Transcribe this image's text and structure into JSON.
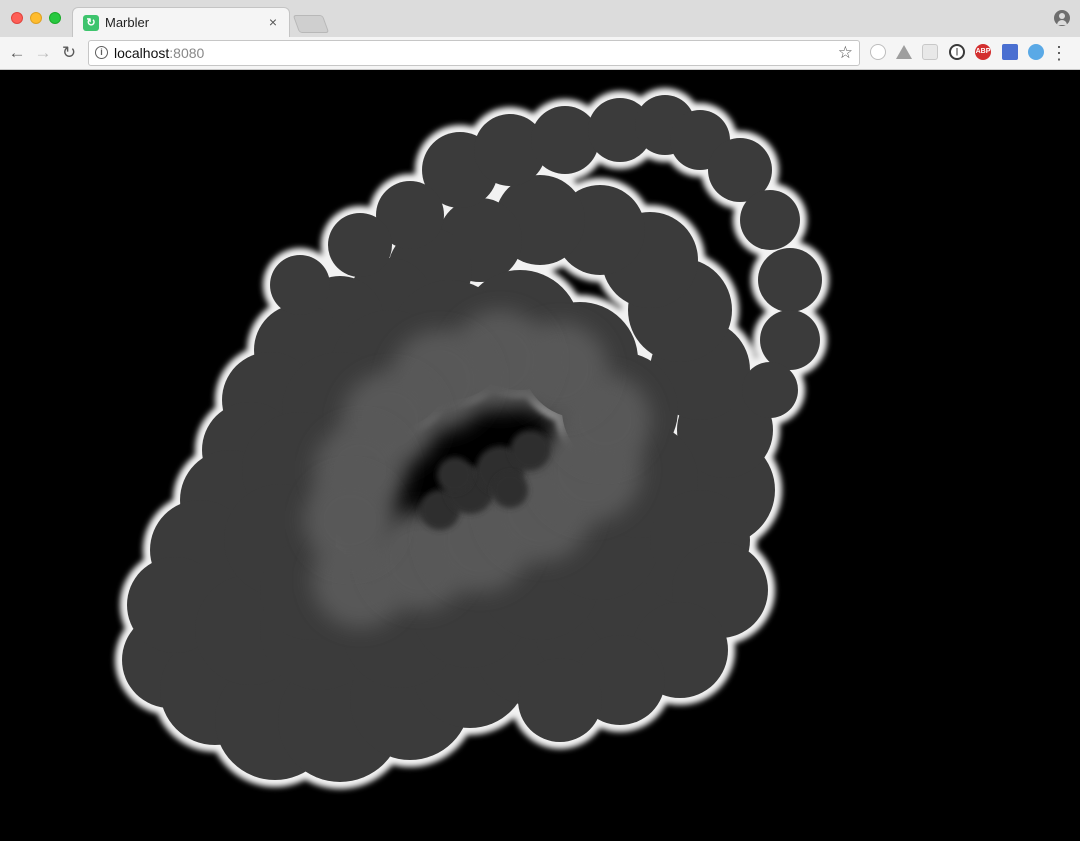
{
  "tab": {
    "title": "Marbler",
    "favicon_glyph": "↻",
    "close_glyph": "×"
  },
  "toolbar": {
    "back_glyph": "←",
    "forward_glyph": "→",
    "reload_glyph": "↻",
    "info_glyph": "i",
    "url_host": "localhost",
    "url_port": ":8080",
    "star_glyph": "☆",
    "menu_glyph": "⋮"
  },
  "extensions": [
    {
      "name": "circle-ext-icon",
      "color": "#bdbdbd"
    },
    {
      "name": "drive-ext-icon",
      "color": "#9e9e9e"
    },
    {
      "name": "grid-ext-icon",
      "color": "#c8c8c8"
    },
    {
      "name": "onepassword-ext-icon",
      "color": "#3a3a3a"
    },
    {
      "name": "adblock-ext-icon",
      "color": "#d32f2f",
      "label": "ABP"
    },
    {
      "name": "meter-ext-icon",
      "color": "#4a6fd1"
    },
    {
      "name": "pulse-ext-icon",
      "color": "#5aa9e6"
    }
  ],
  "colors": {
    "canvas_background": "#000000",
    "marble_dark": "#3b3b3b",
    "marble_mid": "#585858",
    "marble_inner": "#2f2f2f",
    "marble_edge": "#f2f2f2"
  }
}
